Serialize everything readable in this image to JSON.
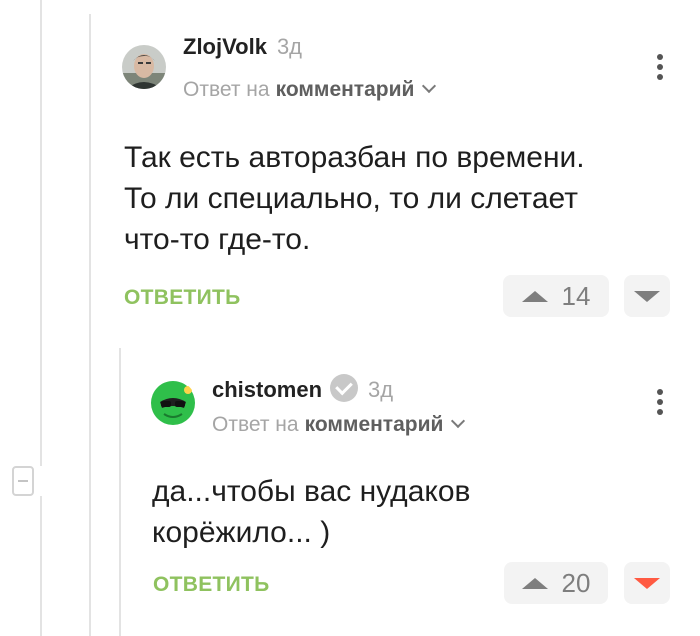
{
  "comments": [
    {
      "author": "ZlojVolk",
      "time": "3д",
      "reply_prefix": "Ответ на",
      "reply_target": "комментарий",
      "text_lines": [
        "Так есть авторазбан по времени.",
        "То ли специально, то ли слетает",
        "что-то где-то."
      ],
      "reply_label": "ОТВЕТИТЬ",
      "rating": "14",
      "downvoted": false
    },
    {
      "author": "chistomen",
      "time": "3д",
      "verified": true,
      "reply_prefix": "Ответ на",
      "reply_target": "комментарий",
      "text_lines": [
        "да...чтобы вас нудаков",
        "корёжило... )"
      ],
      "reply_label": "ОТВЕТИТЬ",
      "rating": "20",
      "downvoted": true
    }
  ],
  "icons": {
    "more": "more-vertical-icon",
    "upvote": "upvote-arrow-icon",
    "downvote": "downvote-arrow-icon",
    "collapse": "collapse-minus-icon",
    "chevron": "chevron-down-icon",
    "verified": "verified-check-icon"
  },
  "colors": {
    "reply_accent": "#8fc25f",
    "downvote_active": "#ff5a42",
    "muted_text": "#a5a5a5"
  }
}
